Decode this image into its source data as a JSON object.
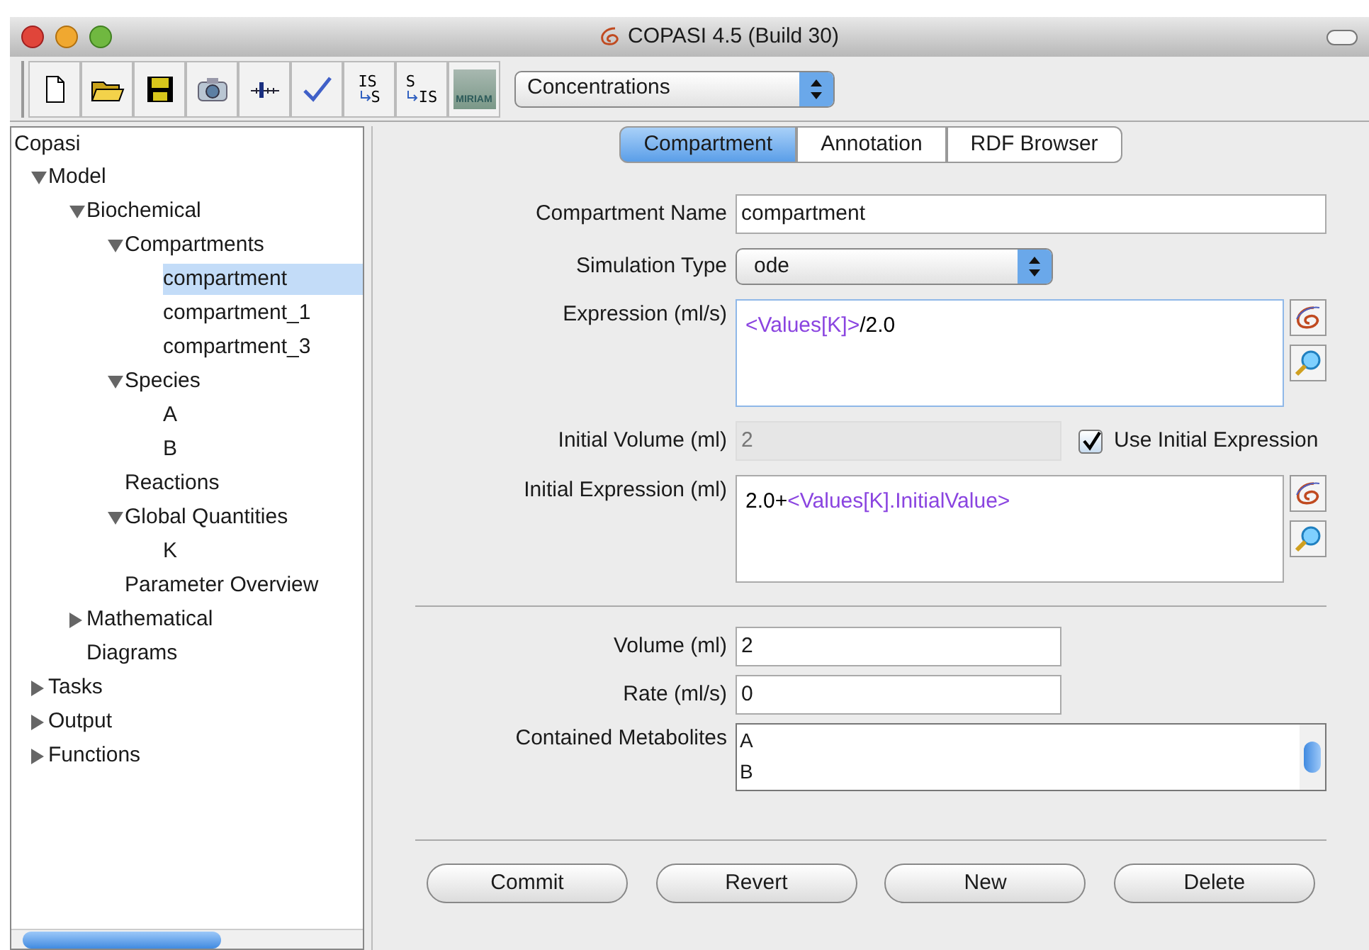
{
  "window": {
    "title": "COPASI 4.5 (Build 30)"
  },
  "toolbar": {
    "buttons": [
      {
        "kind": "new"
      },
      {
        "kind": "open"
      },
      {
        "kind": "save"
      },
      {
        "kind": "camera"
      },
      {
        "kind": "slider"
      },
      {
        "kind": "check"
      },
      {
        "kind": "convert",
        "top": "IS",
        "bottom": "S"
      },
      {
        "kind": "convert",
        "top": "S",
        "bottom": "IS"
      },
      {
        "kind": "miriam",
        "label": "MIRIAM"
      }
    ],
    "unit_select": {
      "value": "Concentrations"
    }
  },
  "tree": {
    "label": "Copasi",
    "selected": false,
    "children": [
      {
        "label": "Model",
        "expanded": true,
        "selected": false,
        "children": [
          {
            "label": "Biochemical",
            "expanded": true,
            "selected": false,
            "children": [
              {
                "label": "Compartments",
                "expanded": true,
                "selected": false,
                "children": [
                  {
                    "label": "compartment",
                    "selected": true
                  },
                  {
                    "label": "compartment_1",
                    "selected": false
                  },
                  {
                    "label": "compartment_3",
                    "selected": false
                  }
                ]
              },
              {
                "label": "Species",
                "expanded": true,
                "selected": false,
                "children": [
                  {
                    "label": "A",
                    "selected": false
                  },
                  {
                    "label": "B",
                    "selected": false
                  }
                ]
              },
              {
                "label": "Reactions",
                "selected": false
              },
              {
                "label": "Global Quantities",
                "expanded": true,
                "selected": false,
                "children": [
                  {
                    "label": "K",
                    "selected": false
                  }
                ]
              },
              {
                "label": "Parameter Overview",
                "selected": false
              }
            ]
          },
          {
            "label": "Mathematical",
            "expanded": false,
            "selected": false
          },
          {
            "label": "Diagrams",
            "selected": false
          }
        ]
      },
      {
        "label": "Tasks",
        "expanded": false,
        "selected": false
      },
      {
        "label": "Output",
        "expanded": false,
        "selected": false
      },
      {
        "label": "Functions",
        "expanded": false,
        "selected": false
      }
    ]
  },
  "tabs": [
    {
      "label": "Compartment",
      "selected": true
    },
    {
      "label": "Annotation",
      "selected": false
    },
    {
      "label": "RDF Browser",
      "selected": false
    }
  ],
  "form": {
    "compartment_name": {
      "label": "Compartment Name",
      "value": "compartment"
    },
    "simulation_type": {
      "label": "Simulation Type",
      "value": "ode"
    },
    "expression": {
      "label": "Expression (ml/s)",
      "segments": [
        {
          "kind": "reference",
          "text": "<Values[K]>"
        },
        {
          "kind": "text",
          "text": "/2.0"
        }
      ]
    },
    "initial_volume": {
      "label": "Initial Volume (ml)",
      "value": "2",
      "disabled": true
    },
    "use_initial_expression": {
      "label": "Use Initial Expression",
      "checked": true
    },
    "initial_expression": {
      "label": "Initial Expression (ml)",
      "segments": [
        {
          "kind": "text",
          "text": "2.0+"
        },
        {
          "kind": "reference",
          "text": "<Values[K].InitialValue>"
        }
      ]
    },
    "volume": {
      "label": "Volume (ml)",
      "value": "2"
    },
    "rate": {
      "label": "Rate (ml/s)",
      "value": "0"
    },
    "contained_metabolites": {
      "label": "Contained Metabolites",
      "items": [
        "A",
        "B"
      ]
    }
  },
  "buttons": [
    "Commit",
    "Revert",
    "New",
    "Delete"
  ]
}
